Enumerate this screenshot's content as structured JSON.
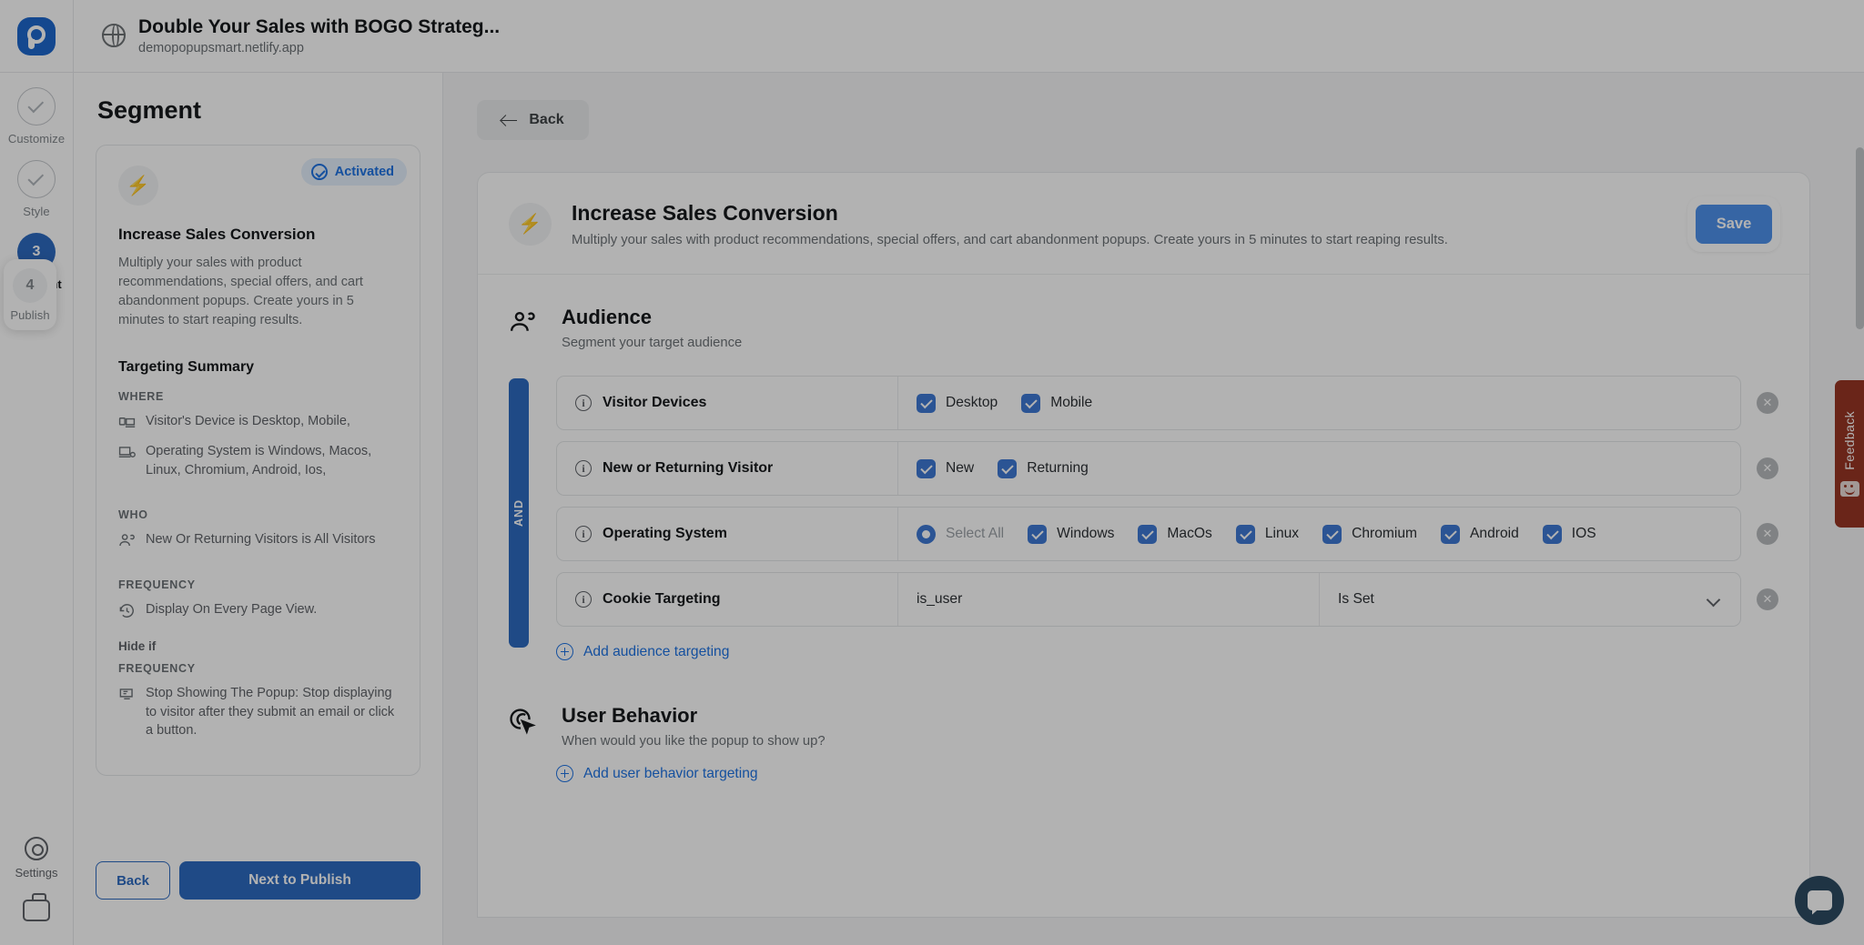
{
  "topbar": {
    "site_title": "Double Your Sales with BOGO Strateg...",
    "site_url": "demopopupsmart.netlify.app",
    "logo_name": "popupsmart-logo"
  },
  "rail": {
    "steps": [
      {
        "label": "Customize",
        "marker": "check",
        "state": "done"
      },
      {
        "label": "Style",
        "marker": "check",
        "state": "done"
      },
      {
        "label": "Segment",
        "marker": "3",
        "state": "active"
      },
      {
        "label": "Publish",
        "marker": "4",
        "state": "hover"
      }
    ],
    "settings_label": "Settings",
    "gear_icon": "gear-icon",
    "briefcase_icon": "briefcase-icon"
  },
  "panel": {
    "title": "Segment",
    "badge": "Activated",
    "card_title": "Increase Sales Conversion",
    "card_desc": "Multiply your sales with product recommendations, special offers, and cart abandonment popups. Create yours in 5 minutes to start reaping results.",
    "summary_title": "Targeting Summary",
    "groups": [
      {
        "label": "WHERE",
        "items": [
          {
            "icon": "device-icon",
            "text": "Visitor's Device is Desktop, Mobile,"
          },
          {
            "icon": "os-icon",
            "text": "Operating System is Windows, Macos, Linux, Chromium, Android, Ios,"
          }
        ]
      },
      {
        "label": "WHO",
        "items": [
          {
            "icon": "visitors-icon",
            "text": "New Or Returning Visitors is All Visitors"
          }
        ]
      },
      {
        "label": "FREQUENCY",
        "items": [
          {
            "icon": "history-icon",
            "text": "Display On Every Page View."
          }
        ]
      }
    ],
    "hide_if_label": "Hide if",
    "hide_groups": [
      {
        "label": "FREQUENCY",
        "items": [
          {
            "icon": "stop-popup-icon",
            "text": "Stop Showing The Popup: Stop displaying to visitor after they submit an email or click a button."
          }
        ]
      }
    ],
    "back_label": "Back",
    "next_label": "Next to Publish"
  },
  "main": {
    "back_label": "Back",
    "header": {
      "title": "Increase Sales Conversion",
      "desc": "Multiply your sales with product recommendations, special offers, and cart abandonment popups. Create yours in 5 minutes to start reaping results.",
      "save_label": "Save",
      "bolt_icon": "bolt-icon"
    },
    "audience": {
      "icon": "audience-icon",
      "title": "Audience",
      "subtitle": "Segment your target audience",
      "and_label": "AND",
      "rules": [
        {
          "name": "Visitor Devices",
          "type": "options",
          "options": [
            {
              "label": "Desktop",
              "control": "checkbox",
              "checked": true
            },
            {
              "label": "Mobile",
              "control": "checkbox",
              "checked": true
            }
          ]
        },
        {
          "name": "New or Returning Visitor",
          "type": "options",
          "options": [
            {
              "label": "New",
              "control": "checkbox",
              "checked": true
            },
            {
              "label": "Returning",
              "control": "checkbox",
              "checked": true
            }
          ]
        },
        {
          "name": "Operating System",
          "type": "options",
          "options": [
            {
              "label": "Select All",
              "control": "radio",
              "checked": true,
              "muted": true
            },
            {
              "label": "Windows",
              "control": "checkbox",
              "checked": true
            },
            {
              "label": "MacOs",
              "control": "checkbox",
              "checked": true
            },
            {
              "label": "Linux",
              "control": "checkbox",
              "checked": true
            },
            {
              "label": "Chromium",
              "control": "checkbox",
              "checked": true
            },
            {
              "label": "Android",
              "control": "checkbox",
              "checked": true
            },
            {
              "label": "IOS",
              "control": "checkbox",
              "checked": true
            }
          ]
        },
        {
          "name": "Cookie Targeting",
          "type": "fields",
          "field_value": "is_user",
          "select_value": "Is Set"
        }
      ],
      "add_label": "Add audience targeting"
    },
    "behavior": {
      "icon": "cursor-target-icon",
      "title": "User Behavior",
      "subtitle": "When would you like the popup to show up?",
      "add_label": "Add user behavior targeting"
    }
  },
  "feedback": {
    "label": "Feedback",
    "icon": "smiley-icon"
  },
  "intercom": {
    "icon": "chat-bubble-icon"
  },
  "colors": {
    "accent": "#2a6ac4",
    "save": "#4a90f0",
    "feedback": "#9b3422",
    "checkbox": "#3b79d8"
  }
}
